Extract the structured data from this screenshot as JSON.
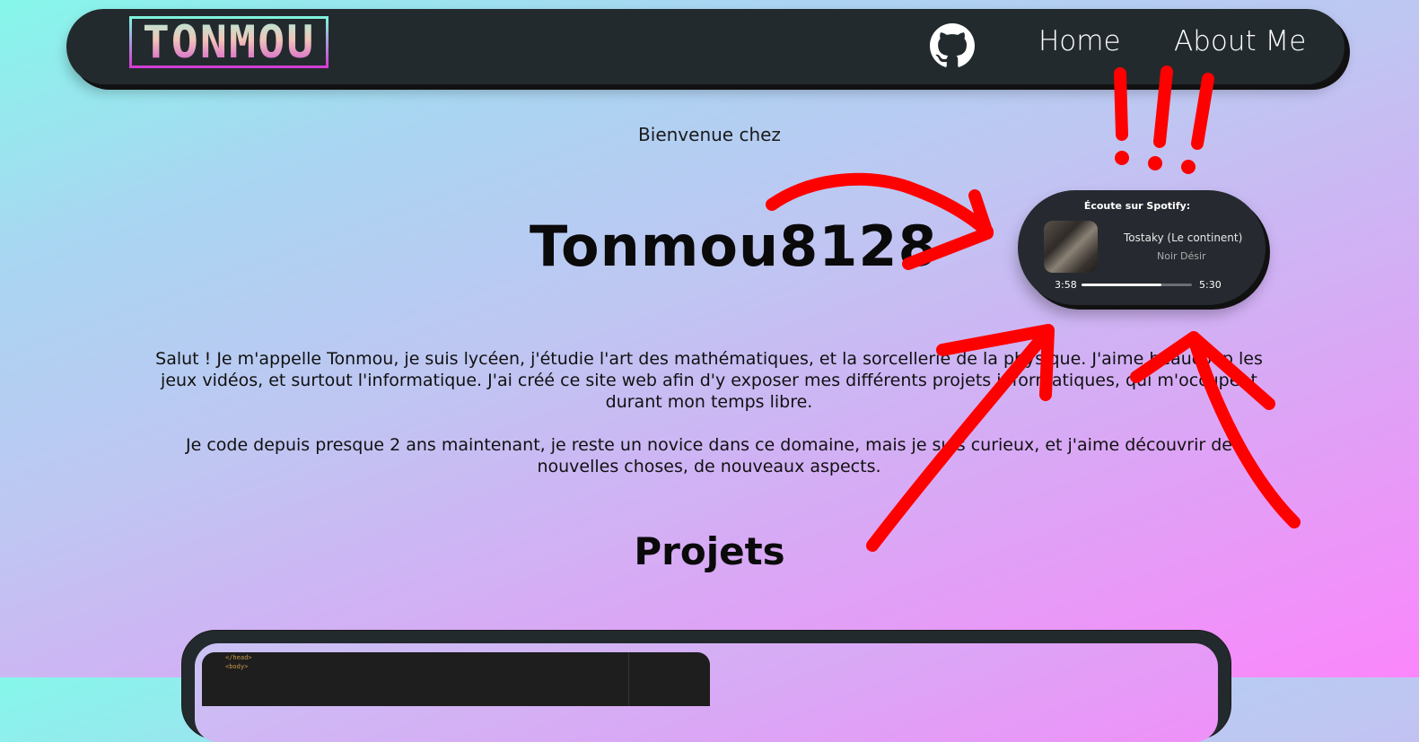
{
  "navbar": {
    "logo_text": "TONMOU",
    "github_icon": "github-icon",
    "links": [
      {
        "label": "Home"
      },
      {
        "label": "About Me"
      }
    ]
  },
  "hero": {
    "welcome": "Bienvenue chez",
    "name": "Tonmou8128"
  },
  "bio": {
    "paragraph1": "Salut ! Je m'appelle Tonmou, je suis lycéen, j'étudie l'art des mathématiques, et la sorcellerie de la physique. J'aime beaucoup les jeux vidéos, et surtout l'informatique. J'ai créé ce site web afin d'y exposer mes différents projets informatiques, qui m'occupent durant mon temps libre.",
    "paragraph2": "Je code depuis presque 2 ans maintenant, je reste un novice dans ce domaine, mais je suis curieux, et j'aime découvrir de nouvelles choses, de nouveaux aspects."
  },
  "projects": {
    "heading": "Projets",
    "code_lines": [
      "</head>",
      "<body>"
    ]
  },
  "spotify": {
    "title": "Écoute sur Spotify:",
    "track": "Tostaky (Le continent)",
    "artist": "Noir Désir",
    "elapsed": "3:58",
    "duration": "5:30",
    "progress_fraction": 0.72
  },
  "annotation": {
    "marks": "!!!",
    "color": "#ff0000"
  },
  "colors": {
    "navbar_bg": "#232a2e",
    "gradient_start": "#86f7ea",
    "gradient_end": "#fb86fb"
  }
}
